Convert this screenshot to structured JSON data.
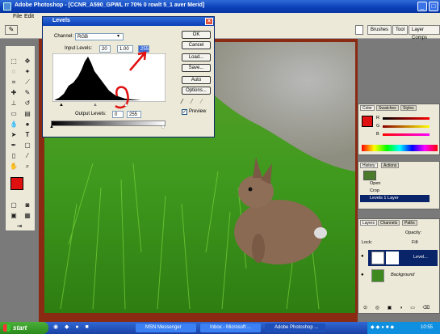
{
  "window": {
    "title": "Adobe Photoshop - [CCNR_A590_GPWL rr 70% 0 rowlt 5_1 aver Merid]",
    "menu": [
      "File",
      "Edit"
    ]
  },
  "options_bar": {
    "tabs": [
      "Brushes",
      "Tool",
      "Layer Comps"
    ]
  },
  "levels_dialog": {
    "title": "Levels",
    "channel_label": "Channel:",
    "channel_value": "RGB",
    "input_levels_label": "Input Levels:",
    "input_values": [
      "20",
      "1.00",
      "255"
    ],
    "output_levels_label": "Output Levels:",
    "output_values": [
      "0",
      "255"
    ],
    "buttons": [
      "OK",
      "Cancel",
      "Load...",
      "Save...",
      "Auto",
      "Options..."
    ],
    "preview_label": "Preview"
  },
  "color_palette": {
    "tabs": [
      "Color",
      "Swatches",
      "Styles"
    ],
    "channels": [
      "R",
      "G",
      "B"
    ]
  },
  "history_palette": {
    "tabs": [
      "History",
      "Actions"
    ],
    "items": [
      "Open",
      "Crop",
      "Levels 1 Layer"
    ]
  },
  "layers_palette": {
    "tabs": [
      "Layers",
      "Channels",
      "Paths"
    ],
    "opacity_label": "Opacity:",
    "fill_label": "Fill:",
    "lock_label": "Lock:",
    "layers": [
      "Level...",
      "Background"
    ]
  },
  "taskbar": {
    "start": "start",
    "tasks": [
      "MSN Messenger",
      "Inbox - Microsoft ...",
      "Adobe Photoshop ..."
    ],
    "clock": "10:55"
  },
  "colors": {
    "foreground": "#e01010",
    "background": "#ffffff",
    "border_brown": "#8a2a12"
  }
}
